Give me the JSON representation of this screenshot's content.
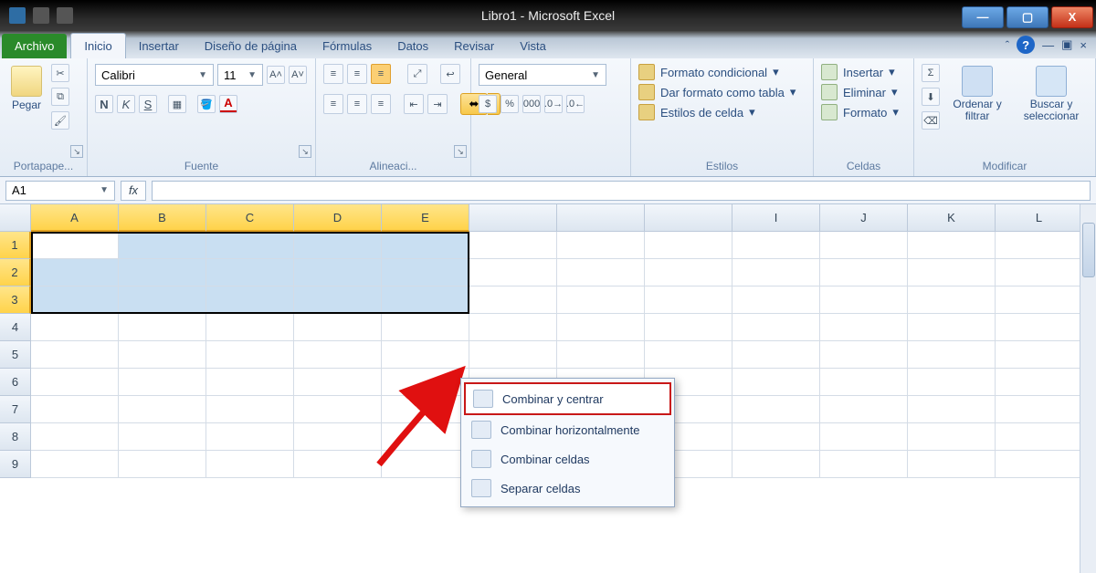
{
  "window": {
    "title": "Libro1 - Microsoft Excel"
  },
  "tabs": {
    "file": "Archivo",
    "items": [
      "Inicio",
      "Insertar",
      "Diseño de página",
      "Fórmulas",
      "Datos",
      "Revisar",
      "Vista"
    ],
    "active": "Inicio"
  },
  "ribbon": {
    "clipboard": {
      "label": "Portapape...",
      "paste": "Pegar"
    },
    "font": {
      "label": "Fuente",
      "name": "Calibri",
      "size": "11"
    },
    "alignment": {
      "label": "Alineaci..."
    },
    "number": {
      "label": "",
      "format": "General",
      "percent": "%",
      "thousands": "000"
    },
    "styles": {
      "label": "Estilos",
      "conditional": "Formato condicional",
      "asTable": "Dar formato como tabla",
      "cellStyles": "Estilos de celda"
    },
    "cells": {
      "label": "Celdas",
      "insert": "Insertar",
      "delete": "Eliminar",
      "format": "Formato"
    },
    "editing": {
      "label": "Modificar",
      "sort": "Ordenar y filtrar",
      "find": "Buscar y seleccionar"
    }
  },
  "formulabar": {
    "cellref": "A1",
    "fx": "fx"
  },
  "columns": [
    "A",
    "B",
    "C",
    "D",
    "E",
    "",
    "",
    "",
    "I",
    "J",
    "K",
    "L"
  ],
  "rows": [
    "1",
    "2",
    "3",
    "4",
    "5",
    "6",
    "7",
    "8",
    "9"
  ],
  "selection": {
    "activeCell": "A1",
    "rangeCols": 5,
    "rangeRows": 3
  },
  "mergeMenu": {
    "items": [
      {
        "key": "center",
        "label": "Combinar y centrar",
        "u": "C"
      },
      {
        "key": "across",
        "label": "Combinar horizontalmente",
        "u": "o"
      },
      {
        "key": "merge",
        "label": "Combinar celdas",
        "u": ""
      },
      {
        "key": "unmerge",
        "label": "Separar celdas",
        "u": "S"
      }
    ],
    "highlighted": "center"
  },
  "help": "?"
}
